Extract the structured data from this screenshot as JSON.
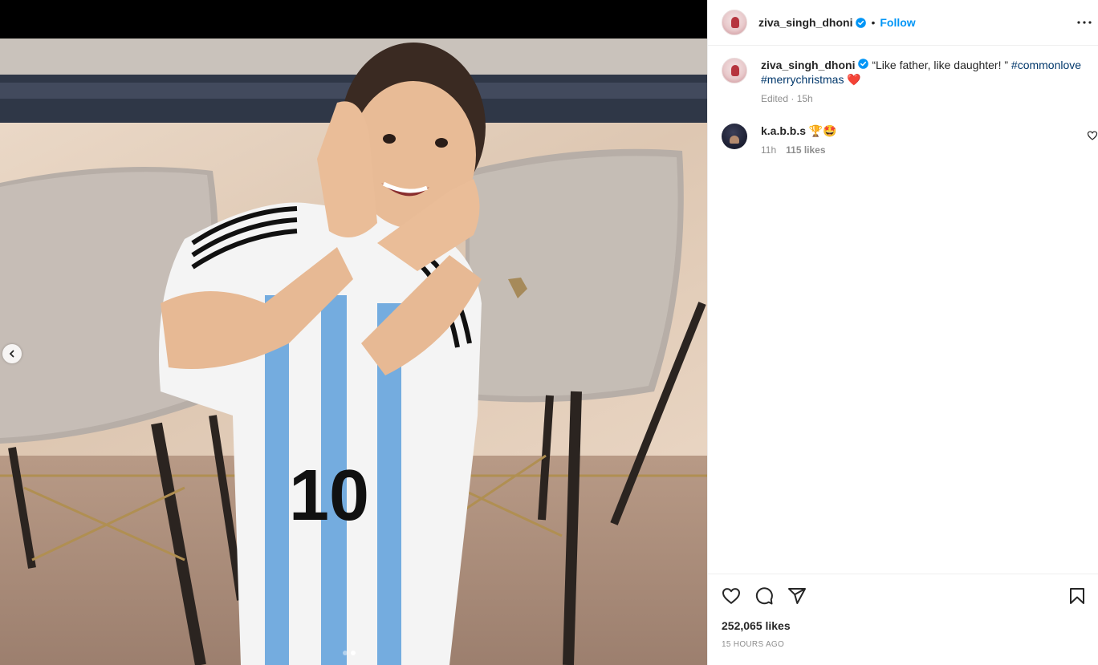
{
  "post": {
    "author": "ziva_singh_dhoni",
    "verified": true,
    "follow_label": "Follow",
    "separator": "•",
    "caption_quote": "“Like father, like daughter! ” ",
    "hashtags": [
      "#commonlove",
      "#merrychristmas"
    ],
    "caption_emoji": "❤️",
    "edited_meta": "Edited · 15h",
    "likes_text": "252,065 likes",
    "timestamp": "15 HOURS AGO"
  },
  "carousel": {
    "total": 2,
    "active_index": 1
  },
  "comments": [
    {
      "user": "k.a.b.b.s",
      "text": "🏆🤩",
      "age": "11h",
      "likes": "115 likes"
    }
  ],
  "icons": {
    "more": "more-options-icon",
    "like": "heart-icon",
    "comment": "comment-icon",
    "share": "share-icon",
    "save": "bookmark-icon",
    "prev": "chevron-left-icon"
  },
  "colors": {
    "accent": "#0095f6",
    "hashtag": "#00376b",
    "muted": "#8e8e8e",
    "heart": "#ed4956"
  }
}
